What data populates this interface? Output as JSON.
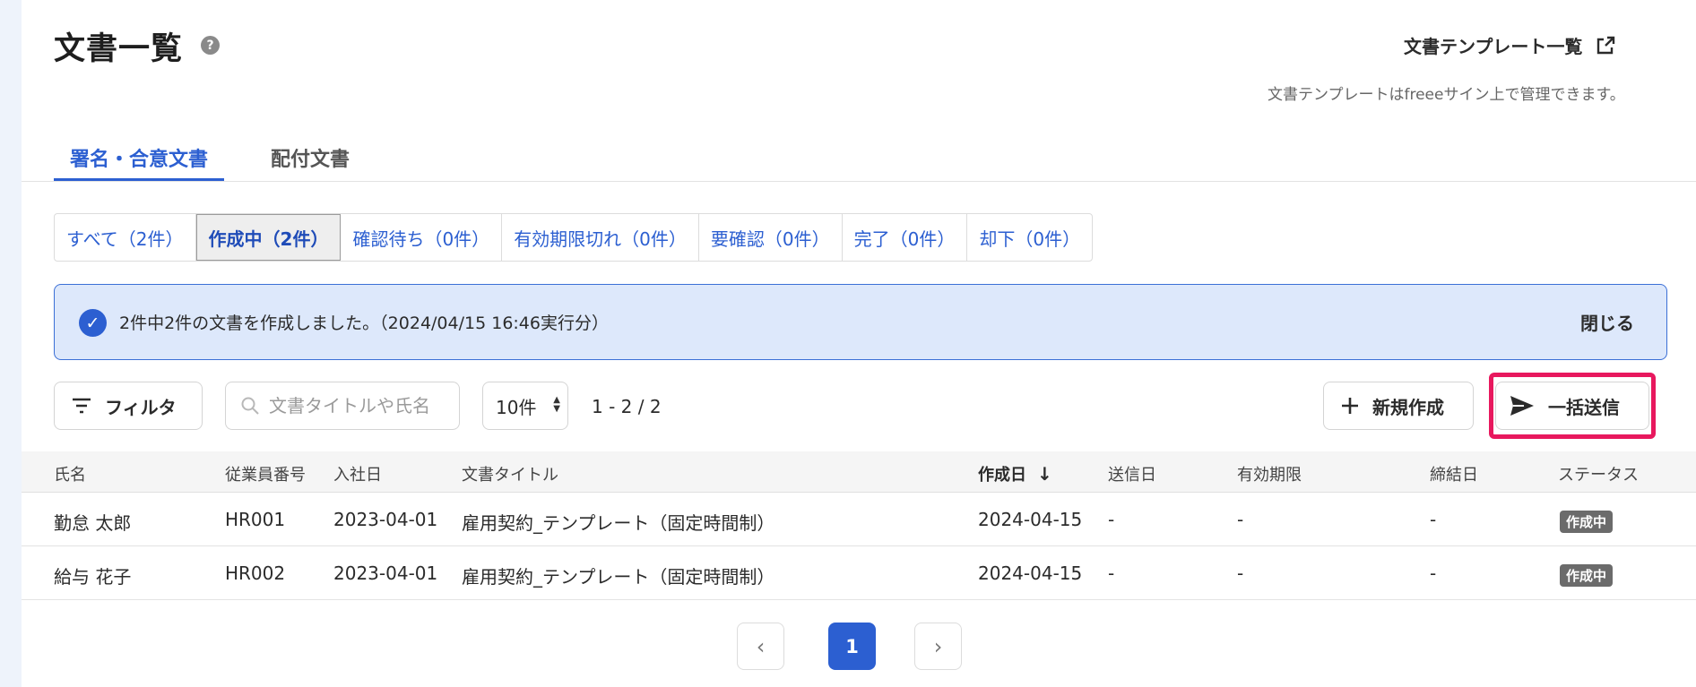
{
  "header": {
    "title": "文書一覧",
    "help_icon": "?",
    "template_link_label": "文書テンプレート一覧",
    "template_note": "文書テンプレートはfreeeサイン上で管理できます。"
  },
  "main_tabs": [
    {
      "label": "署名・合意文書",
      "active": true
    },
    {
      "label": "配付文書",
      "active": false
    }
  ],
  "status_tabs": [
    {
      "label": "すべて（2件）"
    },
    {
      "label": "作成中（2件）",
      "active": true
    },
    {
      "label": "確認待ち（0件）"
    },
    {
      "label": "有効期限切れ（0件）"
    },
    {
      "label": "要確認（0件）"
    },
    {
      "label": "完了（0件）"
    },
    {
      "label": "却下（0件）"
    }
  ],
  "banner": {
    "message": "2件中2件の文書を作成しました。（2024/04/15 16:46実行分）",
    "close_label": "閉じる"
  },
  "toolbar": {
    "filter_label": "フィルタ",
    "search_placeholder": "文書タイトルや氏名",
    "per_page": "10件",
    "range": "1 - 2 / 2",
    "new_label": "新規作成",
    "bulk_send_label": "一括送信"
  },
  "table": {
    "columns": {
      "name": "氏名",
      "employee_no": "従業員番号",
      "join_date": "入社日",
      "doc_title": "文書タイトル",
      "created": "作成日",
      "sent": "送信日",
      "expiry": "有効期限",
      "concluded": "締結日",
      "status": "ステータス"
    },
    "rows": [
      {
        "name": "勤怠 太郎",
        "employee_no": "HR001",
        "join_date": "2023-04-01",
        "doc_title": "雇用契約_テンプレート（固定時間制）",
        "created": "2024-04-15",
        "sent": "-",
        "expiry": "-",
        "concluded": "-",
        "status": "作成中"
      },
      {
        "name": "給与 花子",
        "employee_no": "HR002",
        "join_date": "2023-04-01",
        "doc_title": "雇用契約_テンプレート（固定時間制）",
        "created": "2024-04-15",
        "sent": "-",
        "expiry": "-",
        "concluded": "-",
        "status": "作成中"
      }
    ]
  },
  "pagination": {
    "prev": "‹",
    "current": "1",
    "next": "›"
  }
}
